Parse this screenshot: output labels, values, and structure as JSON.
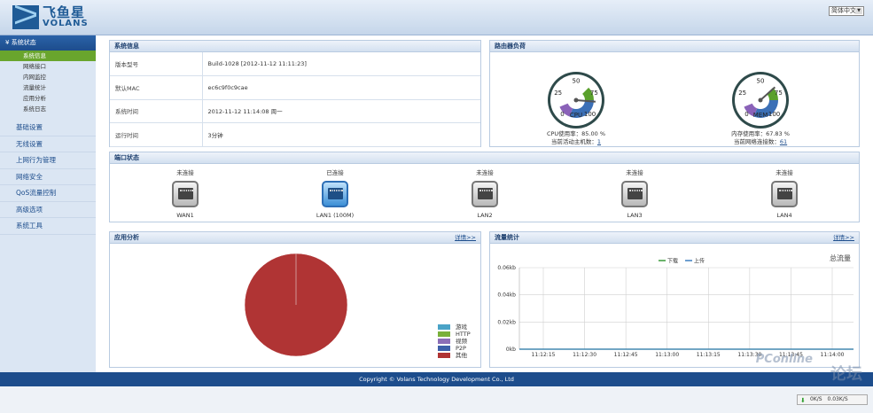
{
  "header": {
    "logo_cn": "飞鱼星",
    "logo_en": "VOLANS",
    "language": "简体中文"
  },
  "sidebar": {
    "section": "系统状态",
    "sub_items": [
      {
        "label": "系统信息",
        "active": true
      },
      {
        "label": "网络接口",
        "active": false
      },
      {
        "label": "内网监控",
        "active": false
      },
      {
        "label": "流量统计",
        "active": false
      },
      {
        "label": "应用分析",
        "active": false
      },
      {
        "label": "系统日志",
        "active": false
      }
    ],
    "menus": [
      "基础设置",
      "无线设置",
      "上网行为管理",
      "网络安全",
      "QoS流量控制",
      "高级选项",
      "系统工具"
    ]
  },
  "system_info": {
    "title": "系统信息",
    "rows": [
      {
        "key": "版本型号",
        "value": "Build-1028 [2012-11-12 11:11:23]"
      },
      {
        "key": "默认MAC",
        "value": "ec6c9f0c9cae"
      },
      {
        "key": "系统时间",
        "value": "2012-11-12 11:14:08 周一"
      },
      {
        "key": "运行时间",
        "value": "3分钟"
      }
    ]
  },
  "router_load": {
    "title": "路由器负荷",
    "cpu": {
      "label": "CPU",
      "usage_text": "CPU使用率：85.00 %",
      "active_hosts_label": "当前活动主机数：",
      "active_hosts": "1",
      "value": 85.0
    },
    "mem": {
      "label": "MEM",
      "usage_text": "内存使用率：67.83 %",
      "connections_label": "当前网络连接数：",
      "connections": "61",
      "value": 67.83
    },
    "ticks": [
      "0",
      "25",
      "50",
      "75",
      "100"
    ]
  },
  "ports": {
    "title": "端口状态",
    "items": [
      {
        "status": "未连接",
        "name": "WAN1",
        "connected": false
      },
      {
        "status": "已连接",
        "name": "LAN1 (100M)",
        "connected": true
      },
      {
        "status": "未连接",
        "name": "LAN2",
        "connected": false
      },
      {
        "status": "未连接",
        "name": "LAN3",
        "connected": false
      },
      {
        "status": "未连接",
        "name": "LAN4",
        "connected": false
      }
    ]
  },
  "app_analysis": {
    "title": "应用分析",
    "more": "详情>>",
    "chart_data": {
      "type": "pie",
      "slices": [
        {
          "label": "游戏",
          "value": 0,
          "color": "#4aa3c7"
        },
        {
          "label": "HTTP",
          "value": 0,
          "color": "#79b03a"
        },
        {
          "label": "视频",
          "value": 0,
          "color": "#8b6db6"
        },
        {
          "label": "P2P",
          "value": 0,
          "color": "#3d5fa8"
        },
        {
          "label": "其他",
          "value": 100,
          "color": "#b03434"
        }
      ]
    }
  },
  "traffic": {
    "title": "流量统计",
    "more": "详情>>",
    "total_label": "总流量",
    "chart_data": {
      "type": "line",
      "x": [
        "11:12:15",
        "11:12:30",
        "11:12:45",
        "11:13:00",
        "11:13:15",
        "11:13:30",
        "11:13:45",
        "11:14:00"
      ],
      "y_ticks": [
        "0kb",
        "0.02kb",
        "0.04kb",
        "0.06kb"
      ],
      "ylim": [
        0,
        0.06
      ],
      "series": [
        {
          "name": "下载",
          "color": "#3a9b3a",
          "values": [
            0,
            0,
            0,
            0,
            0,
            0,
            0,
            0
          ]
        },
        {
          "name": "上传",
          "color": "#3d7fc0",
          "values": [
            0,
            0,
            0,
            0,
            0,
            0,
            0,
            0
          ]
        }
      ]
    }
  },
  "footer": {
    "copyright": "Copyright © Volans Technology Development Co., Ltd"
  },
  "watermark": {
    "brand": "PConline",
    "suffix": "论坛"
  },
  "tray": {
    "down": "0K/S",
    "up": "0.03K/S"
  }
}
